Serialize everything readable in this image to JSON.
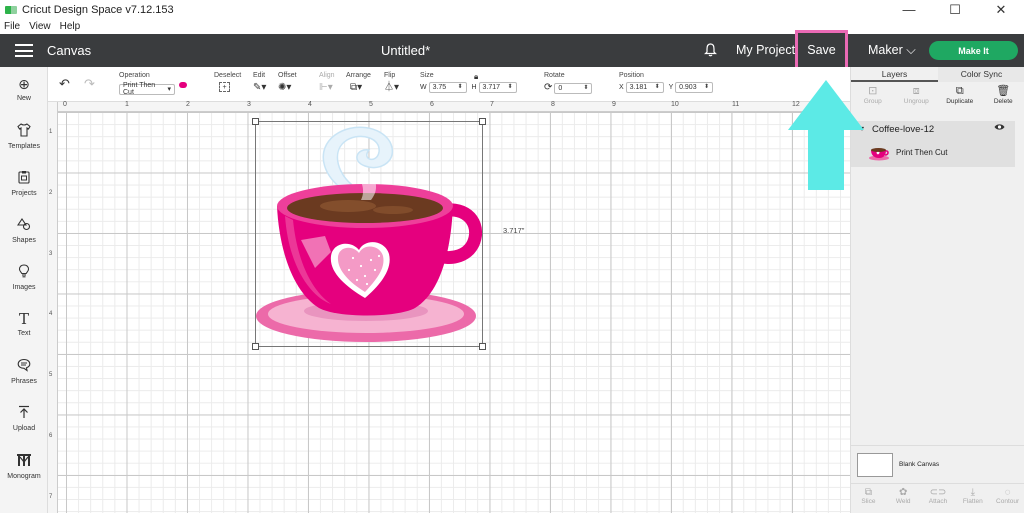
{
  "window": {
    "title": "Cricut Design Space  v7.12.153",
    "controls": [
      "—",
      "☐",
      "✕"
    ]
  },
  "menubar": [
    "File",
    "View",
    "Help"
  ],
  "header": {
    "canvas_label": "Canvas",
    "doc_title": "Untitled*",
    "my_projects": "My Projects",
    "save": "Save",
    "machine": "Maker",
    "make_it": "Make It"
  },
  "toolbar": {
    "operation_label": "Operation",
    "operation_value": "Print Then Cut",
    "deselect": "Deselect",
    "edit": "Edit",
    "offset": "Offset",
    "align": "Align",
    "arrange": "Arrange",
    "flip": "Flip",
    "size_label": "Size",
    "w_label": "W",
    "w_value": "3.75",
    "h_label": "H",
    "h_value": "3.717",
    "rotate_label": "Rotate",
    "rotate_value": "0",
    "position_label": "Position",
    "x_label": "X",
    "x_value": "3.181",
    "y_label": "Y",
    "y_value": "0.903"
  },
  "sidebar": {
    "items": [
      {
        "label": "New",
        "icon": "plus-circle-icon"
      },
      {
        "label": "Templates",
        "icon": "shirt-icon"
      },
      {
        "label": "Projects",
        "icon": "clipboard-icon"
      },
      {
        "label": "Shapes",
        "icon": "shapes-icon"
      },
      {
        "label": "Images",
        "icon": "lightbulb-icon"
      },
      {
        "label": "Text",
        "icon": "text-icon"
      },
      {
        "label": "Phrases",
        "icon": "speech-bubble-icon"
      },
      {
        "label": "Upload",
        "icon": "upload-icon"
      },
      {
        "label": "Monogram",
        "icon": "monogram-icon"
      }
    ]
  },
  "rulers": {
    "top": [
      "0",
      "1",
      "2",
      "3",
      "4",
      "5",
      "6",
      "7",
      "8",
      "9",
      "10",
      "11",
      "12"
    ],
    "left": [
      "1",
      "2",
      "3",
      "4",
      "5",
      "6",
      "7"
    ]
  },
  "canvas": {
    "height_label": "3.717\""
  },
  "layers_panel": {
    "tabs": [
      "Layers",
      "Color Sync"
    ],
    "tools": [
      "Group",
      "Ungroup",
      "Duplicate",
      "Delete"
    ],
    "group_name": "Coffee-love-12",
    "layer_name": "Print Then Cut",
    "blank_canvas": "Blank Canvas",
    "bottom_tools": [
      "Slice",
      "Weld",
      "Attach",
      "Flatten",
      "Contour"
    ]
  },
  "colors": {
    "header_bg": "#3a3c3e",
    "make_it": "#1fa862",
    "highlight_box": "#ea6ab5",
    "arrow": "#5ceae6",
    "cup_pink": "#e5007e"
  }
}
